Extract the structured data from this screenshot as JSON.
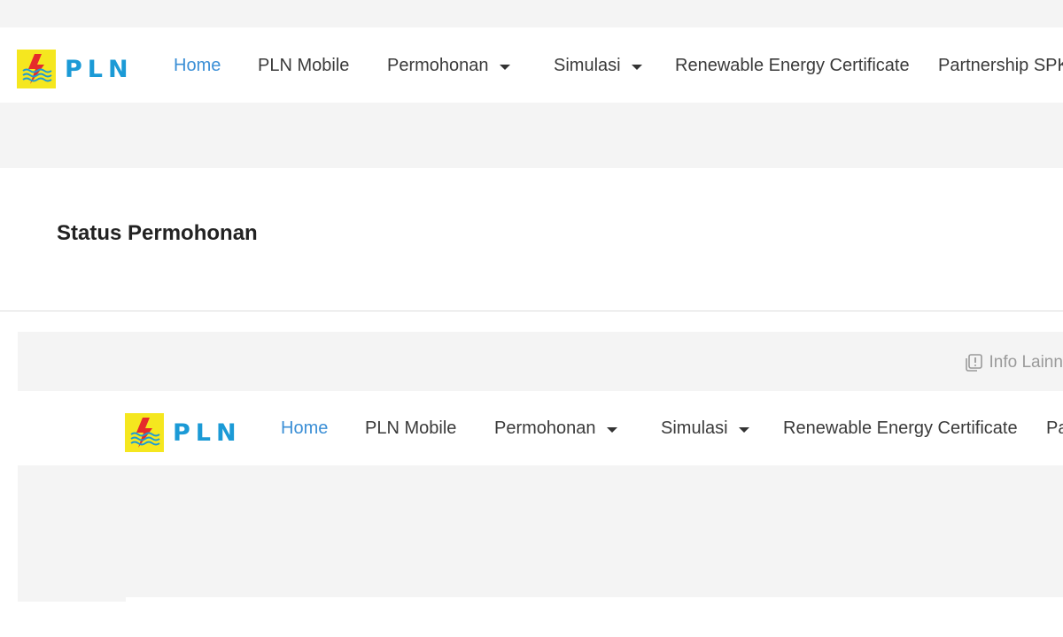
{
  "brand": {
    "name": "PLN",
    "logo_icon": "pln-lightning-logo-icon",
    "primary_color": "#1b9ad6",
    "logo_bg_color": "#f5e71f"
  },
  "nav": {
    "items": [
      {
        "label": "Home",
        "active": true
      },
      {
        "label": "PLN Mobile"
      },
      {
        "label": "Permohonan",
        "dropdown": true
      },
      {
        "label": "Simulasi",
        "dropdown": true
      },
      {
        "label": "Renewable Energy Certificate"
      },
      {
        "label": "Partnership SPKLU"
      }
    ]
  },
  "page": {
    "title": "Status Permohonan"
  },
  "embedded": {
    "info_label": "Info Lainnya",
    "info_icon": "info-document-icon",
    "nav": {
      "items": [
        {
          "label": "Home",
          "active": true
        },
        {
          "label": "PLN Mobile"
        },
        {
          "label": "Permohonan",
          "dropdown": true
        },
        {
          "label": "Simulasi",
          "dropdown": true
        },
        {
          "label": "Renewable Energy Certificate"
        },
        {
          "label": "Partnership SPKLU"
        }
      ]
    }
  },
  "colors": {
    "active_link": "#3b8fd6",
    "text": "#3a3a3a",
    "band_gray": "#f4f4f4"
  }
}
